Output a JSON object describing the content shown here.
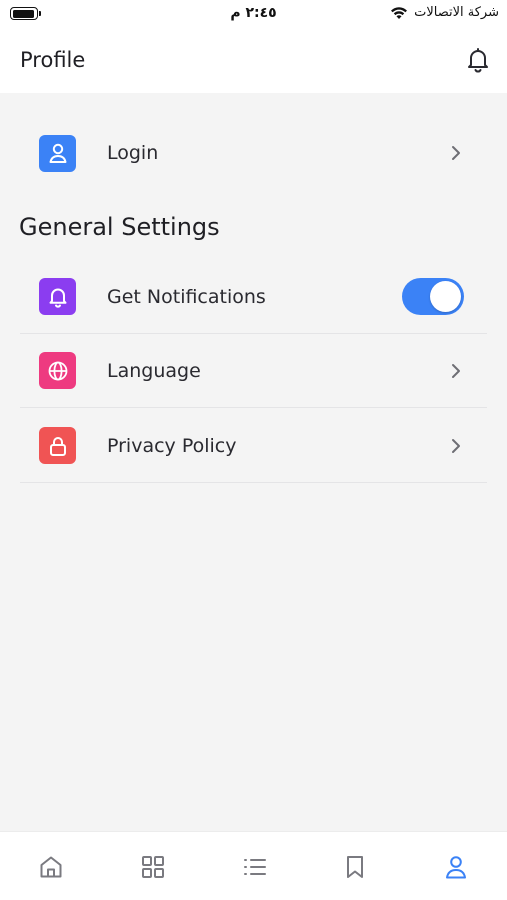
{
  "status_bar": {
    "time": "٢:٤٥ م",
    "carrier": "شركة الاتصالات",
    "icons": [
      "battery-icon",
      "wifi-icon"
    ]
  },
  "header": {
    "title": "Profile",
    "icon": "bell-icon"
  },
  "login_row": {
    "label": "Login",
    "icon": "user-icon",
    "icon_color": "#3b82f6"
  },
  "general_settings": {
    "title": "General Settings",
    "items": [
      {
        "label": "Get Notifications",
        "icon": "bell-icon",
        "icon_color": "#8b3df0",
        "control": "toggle",
        "toggle_on": true
      },
      {
        "label": "Language",
        "icon": "globe-icon",
        "icon_color": "#ee3a80",
        "control": "chevron"
      },
      {
        "label": "Privacy Policy",
        "icon": "lock-icon",
        "icon_color": "#f05454",
        "control": "chevron"
      }
    ]
  },
  "tab_bar": {
    "tabs": [
      {
        "name": "home",
        "icon": "home-icon",
        "active": false
      },
      {
        "name": "categories",
        "icon": "grid-icon",
        "active": false
      },
      {
        "name": "list",
        "icon": "list-icon",
        "active": false
      },
      {
        "name": "bookmarks",
        "icon": "bookmark-icon",
        "active": false
      },
      {
        "name": "profile",
        "icon": "user-icon",
        "active": true
      }
    ],
    "active_color": "#3b82f6",
    "inactive_color": "#7a7a80"
  },
  "colors": {
    "accent": "#3b82f6",
    "toggle_on": "#3b82f6",
    "background": "#f4f4f4"
  }
}
